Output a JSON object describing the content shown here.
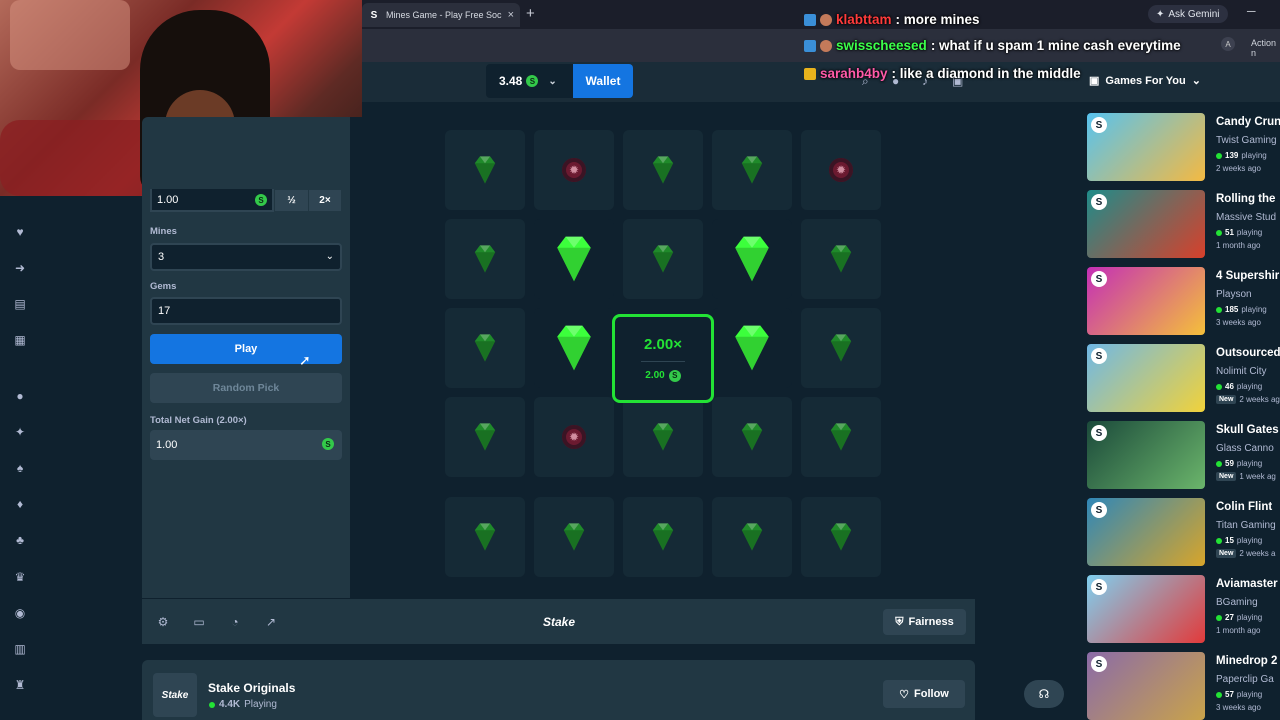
{
  "browser": {
    "tab_title": "Mines Game - Play Free Social C",
    "tab_favicon": "S",
    "tab_close": "×",
    "new_tab": "+",
    "ask_gemini": "Ask Gemini",
    "minimize": "─",
    "profile_initial": "A",
    "action_text": "Action n"
  },
  "header": {
    "balance": "3.48",
    "currency_symbol": "S",
    "wallet_label": "Wallet"
  },
  "chat": [
    {
      "user": "klabttam",
      "user_color": "#ff3b3b",
      "message": ": more mines"
    },
    {
      "user": "swisscheesed",
      "user_color": "#3bff4a",
      "message": ": what if u spam 1 mine cash everytime"
    },
    {
      "user": "sarahb4by",
      "user_color": "#ff5aa8",
      "message": ": like a diamond in the middle"
    }
  ],
  "controls": {
    "bet_amount": "1.00",
    "half": "½",
    "double": "2×",
    "mines_label": "Mines",
    "mines_value": "3",
    "gems_label": "Gems",
    "gems_value": "17",
    "play_label": "Play",
    "random_label": "Random Pick",
    "net_gain_label": "Total Net Gain (2.00×)",
    "net_gain_value": "1.00"
  },
  "board": {
    "grid": [
      [
        "gem",
        "mine",
        "gem",
        "gem",
        "mine"
      ],
      [
        "gem",
        "gem-big",
        "gem",
        "gem-big",
        "gem"
      ],
      [
        "gem",
        "gem-big",
        "multiplier",
        "gem-big",
        "gem"
      ],
      [
        "gem",
        "mine",
        "gem",
        "gem",
        "gem"
      ],
      [
        "gem",
        "gem",
        "gem",
        "gem",
        "gem"
      ]
    ],
    "multiplier": "2.00×",
    "payout": "2.00",
    "gem_color": "#1f8a2a",
    "gem_big_color": "#3cff3c",
    "highlight_color": "#23e235"
  },
  "footer": {
    "logo": "Stake",
    "fairness": "Fairness"
  },
  "originals": {
    "logo": "Stake",
    "title": "Stake Originals",
    "count": "4.4K",
    "count_label": "Playing",
    "follow": "Follow"
  },
  "games_for_you": {
    "heading": "Games For You",
    "items": [
      {
        "title": "Candy Crun",
        "studio": "Twist Gaming",
        "playing": "139",
        "playing_label": "playing",
        "age": "2 weeks ago",
        "is_new": false,
        "c1": "#57c3ef",
        "c2": "#f4b942"
      },
      {
        "title": "Rolling the",
        "studio": "Massive Stud",
        "playing": "51",
        "playing_label": "playing",
        "age": "1 month ago",
        "is_new": false,
        "c1": "#1f8c8a",
        "c2": "#d8402b"
      },
      {
        "title": "4 Supershir",
        "studio": "Playson",
        "playing": "185",
        "playing_label": "playing",
        "age": "3 weeks ago",
        "is_new": false,
        "c1": "#c42fb6",
        "c2": "#f5c03a"
      },
      {
        "title": "Outsourced",
        "studio": "Nolimit City",
        "playing": "46",
        "playing_label": "playing",
        "age": "2 weeks ag",
        "is_new": true,
        "c1": "#6fb8e6",
        "c2": "#f1d23a"
      },
      {
        "title": "Skull Gates",
        "studio": "Glass Canno",
        "playing": "59",
        "playing_label": "playing",
        "age": "1 week ag",
        "is_new": true,
        "c1": "#1b4a3b",
        "c2": "#6bb56b"
      },
      {
        "title": "Colin Flint",
        "studio": "Titan Gaming",
        "playing": "15",
        "playing_label": "playing",
        "age": "2 weeks a",
        "is_new": true,
        "c1": "#2f87b8",
        "c2": "#d8a52a"
      },
      {
        "title": "Aviamaster",
        "studio": "BGaming",
        "playing": "27",
        "playing_label": "playing",
        "age": "1 month ago",
        "is_new": false,
        "c1": "#7fd0f0",
        "c2": "#e23a3a"
      },
      {
        "title": "Minedrop 2",
        "studio": "Paperclip Ga",
        "playing": "57",
        "playing_label": "playing",
        "age": "3 weeks ago",
        "is_new": false,
        "c1": "#8b6ba8",
        "c2": "#c9a34a"
      }
    ],
    "new_label": "New"
  }
}
